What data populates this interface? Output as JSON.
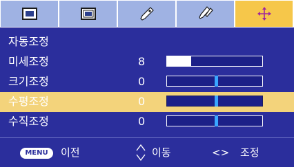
{
  "tabs": [
    {
      "icon": "screen-picture-icon"
    },
    {
      "icon": "screen-inset-icon"
    },
    {
      "icon": "settings-tool-icon"
    },
    {
      "icon": "option-tool-icon"
    },
    {
      "icon": "position-move-icon"
    }
  ],
  "menu": {
    "items": [
      {
        "label": "자동조정",
        "value": ""
      },
      {
        "label": "미세조정",
        "value": "8",
        "level": 0.25
      },
      {
        "label": "크기조정",
        "value": "0",
        "level": 0.5
      },
      {
        "label": "수평조정",
        "value": "0",
        "level": 0.5
      },
      {
        "label": "수직조정",
        "value": "0",
        "level": 0.5
      }
    ],
    "selected_index": 3
  },
  "footer": {
    "menu_button": "MENU",
    "back_label": "이전",
    "move_label": "이동",
    "adjust_symbol": "<>",
    "adjust_label": "조정"
  },
  "colors": {
    "background": "#2b2e9c",
    "tab": "#9fb2e3",
    "tab_active": "#f6c74a",
    "selected_row": "#f3d37b",
    "marker": "#3aa6ff"
  }
}
